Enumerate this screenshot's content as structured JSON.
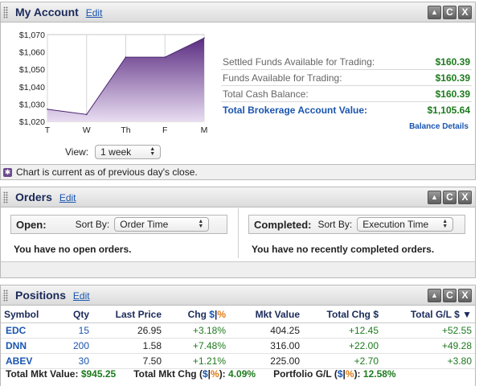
{
  "account": {
    "title": "My Account",
    "edit": "Edit",
    "chart_data": {
      "type": "area",
      "x": [
        "T",
        "W",
        "Th",
        "F",
        "M"
      ],
      "values": [
        1027,
        1024,
        1057,
        1057,
        1068
      ],
      "ylim": [
        1020,
        1070
      ],
      "yticks": [
        "$1,070",
        "$1,060",
        "$1,050",
        "$1,040",
        "$1,030",
        "$1,020"
      ],
      "xlabel": "",
      "ylabel": "",
      "title": ""
    },
    "view_label": "View:",
    "view_value": "1 week",
    "balances": [
      {
        "label": "Settled Funds Available for Trading:",
        "value": "$160.39"
      },
      {
        "label": "Funds Available for Trading:",
        "value": "$160.39"
      },
      {
        "label": "Total Cash Balance:",
        "value": "$160.39"
      },
      {
        "label": "Total Brokerage Account Value:",
        "value": "$1,105.64"
      }
    ],
    "balance_details": "Balance Details",
    "note": "Chart is current as of previous day's close."
  },
  "orders": {
    "title": "Orders",
    "edit": "Edit",
    "open_label": "Open:",
    "open_sort_label": "Sort By:",
    "open_sort_value": "Order Time",
    "open_msg": "You have no open orders.",
    "completed_label": "Completed:",
    "completed_sort_label": "Sort By:",
    "completed_sort_value": "Execution Time",
    "completed_msg": "You have no recently completed orders."
  },
  "positions": {
    "title": "Positions",
    "edit": "Edit",
    "headers": {
      "symbol": "Symbol",
      "qty": "Qty",
      "last": "Last Price",
      "chg": "Chg",
      "dollar": "$",
      "sep": "|",
      "pct": "%",
      "mkt": "Mkt Value",
      "totchg": "Total Chg $",
      "totgl": "Total G/L $",
      "sort_arrow": "▼"
    },
    "rows": [
      {
        "symbol": "EDC",
        "qty": "15",
        "last": "26.95",
        "chg": "+3.18%",
        "mkt": "404.25",
        "totchg": "+12.45",
        "totgl": "+52.55"
      },
      {
        "symbol": "DNN",
        "qty": "200",
        "last": "1.58",
        "chg": "+7.48%",
        "mkt": "316.00",
        "totchg": "+22.00",
        "totgl": "+49.28"
      },
      {
        "symbol": "ABEV",
        "qty": "30",
        "last": "7.50",
        "chg": "+1.21%",
        "mkt": "225.00",
        "totchg": "+2.70",
        "totgl": "+3.80"
      }
    ],
    "summary": {
      "mkt_label": "Total Mkt Value:",
      "mkt_value": "$945.25",
      "chg_label": "Total Mkt Chg (",
      "chg_value": "4.09%",
      "gl_label": "Portfolio G/L (",
      "gl_value": "12.58%",
      "close_paren": "):",
      "dollar": "$",
      "sep": "|",
      "pct": "%"
    }
  },
  "controls": {
    "collapse": "▲",
    "refresh": "C",
    "close": "X"
  },
  "colors": {
    "area_dark": "#5b2d82",
    "area_light": "#e8dcf1",
    "positive": "#1d7a1d",
    "link": "#1a55b0"
  }
}
